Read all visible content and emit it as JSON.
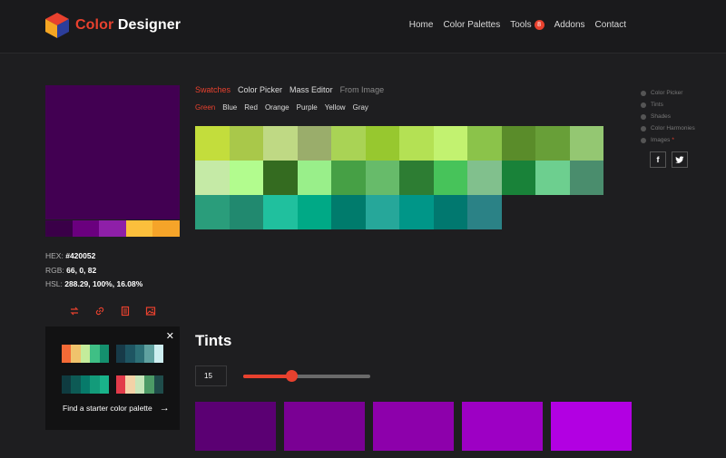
{
  "header": {
    "brand_part1": "Color",
    "brand_part2": "Designer",
    "nav": [
      {
        "label": "Home"
      },
      {
        "label": "Color Palettes"
      },
      {
        "label": "Tools",
        "badge": "8"
      },
      {
        "label": "Addons"
      },
      {
        "label": "Contact"
      }
    ]
  },
  "colors": {
    "accent": "#e8412e",
    "selected": "#420052"
  },
  "selected": {
    "hex_label": "HEX:",
    "hex_value": "#420052",
    "rgb_label": "RGB:",
    "rgb_value": "66, 0, 82",
    "hsl_label": "HSL:",
    "hsl_value": "288.29, 100%, 16.08%",
    "shades": [
      "#3a0048",
      "#6a007e",
      "#8e1fa8",
      "#fbbf3c",
      "#f5a429"
    ]
  },
  "tool_icons": [
    "swap-icon",
    "link-icon",
    "document-icon",
    "image-icon"
  ],
  "starter": {
    "link_label": "Find a starter color palette",
    "arrow": "→",
    "close": "✕",
    "palettes": [
      [
        "#f46a36",
        "#f0c36c",
        "#c4ec9b",
        "#3fbf85",
        "#14906e"
      ],
      [
        "#173a48",
        "#1e5562",
        "#2d7077",
        "#5fa1a0",
        "#cdeef0"
      ],
      [
        "#0f3b40",
        "#0d5a55",
        "#077a6a",
        "#139b7a",
        "#19b38a"
      ],
      [
        "#e23b4a",
        "#f3d2a7",
        "#c7e6ba",
        "#4c9a66",
        "#1f4c4a"
      ]
    ]
  },
  "tabs": {
    "main": [
      "Swatches",
      "Color Picker",
      "Mass Editor",
      "From Image"
    ],
    "sub": [
      "Green",
      "Blue",
      "Red",
      "Orange",
      "Purple",
      "Yellow",
      "Gray"
    ]
  },
  "swatch_grid": [
    [
      "#c3dd3c",
      "#a9c84a",
      "#bfd984",
      "#9aad6b",
      "#a9d355",
      "#97c82f",
      "#b4e154",
      "#c2f270",
      "#8bc34a",
      "#5a8c2a",
      "#689f38",
      "#94c772"
    ],
    [
      "#c5eaa6",
      "#b2fc8e",
      "#346b20",
      "#99ef8a",
      "#46a045",
      "#67bb6a",
      "#2d7d33",
      "#47c35a",
      "#81c08d",
      "#198239",
      "#6dcf8f",
      "#4a8d6d"
    ],
    [
      "#2a9d7b",
      "#21896f",
      "#20c09e",
      "#00a986",
      "#007b6c",
      "#26a79a",
      "#009688",
      "#01786f",
      "#2b8286"
    ]
  ],
  "sidebar": {
    "items": [
      "Color Picker",
      "Tints",
      "Shades",
      "Color Harmonies",
      "Images"
    ],
    "images_marker": "*",
    "social": [
      "f",
      "t"
    ]
  },
  "tints": {
    "title": "Tints",
    "count": "15",
    "slider_value": 0.38,
    "swatches": [
      "#5b0073",
      "#7a0094",
      "#8d00ab",
      "#9d00c4",
      "#b200e2"
    ]
  }
}
